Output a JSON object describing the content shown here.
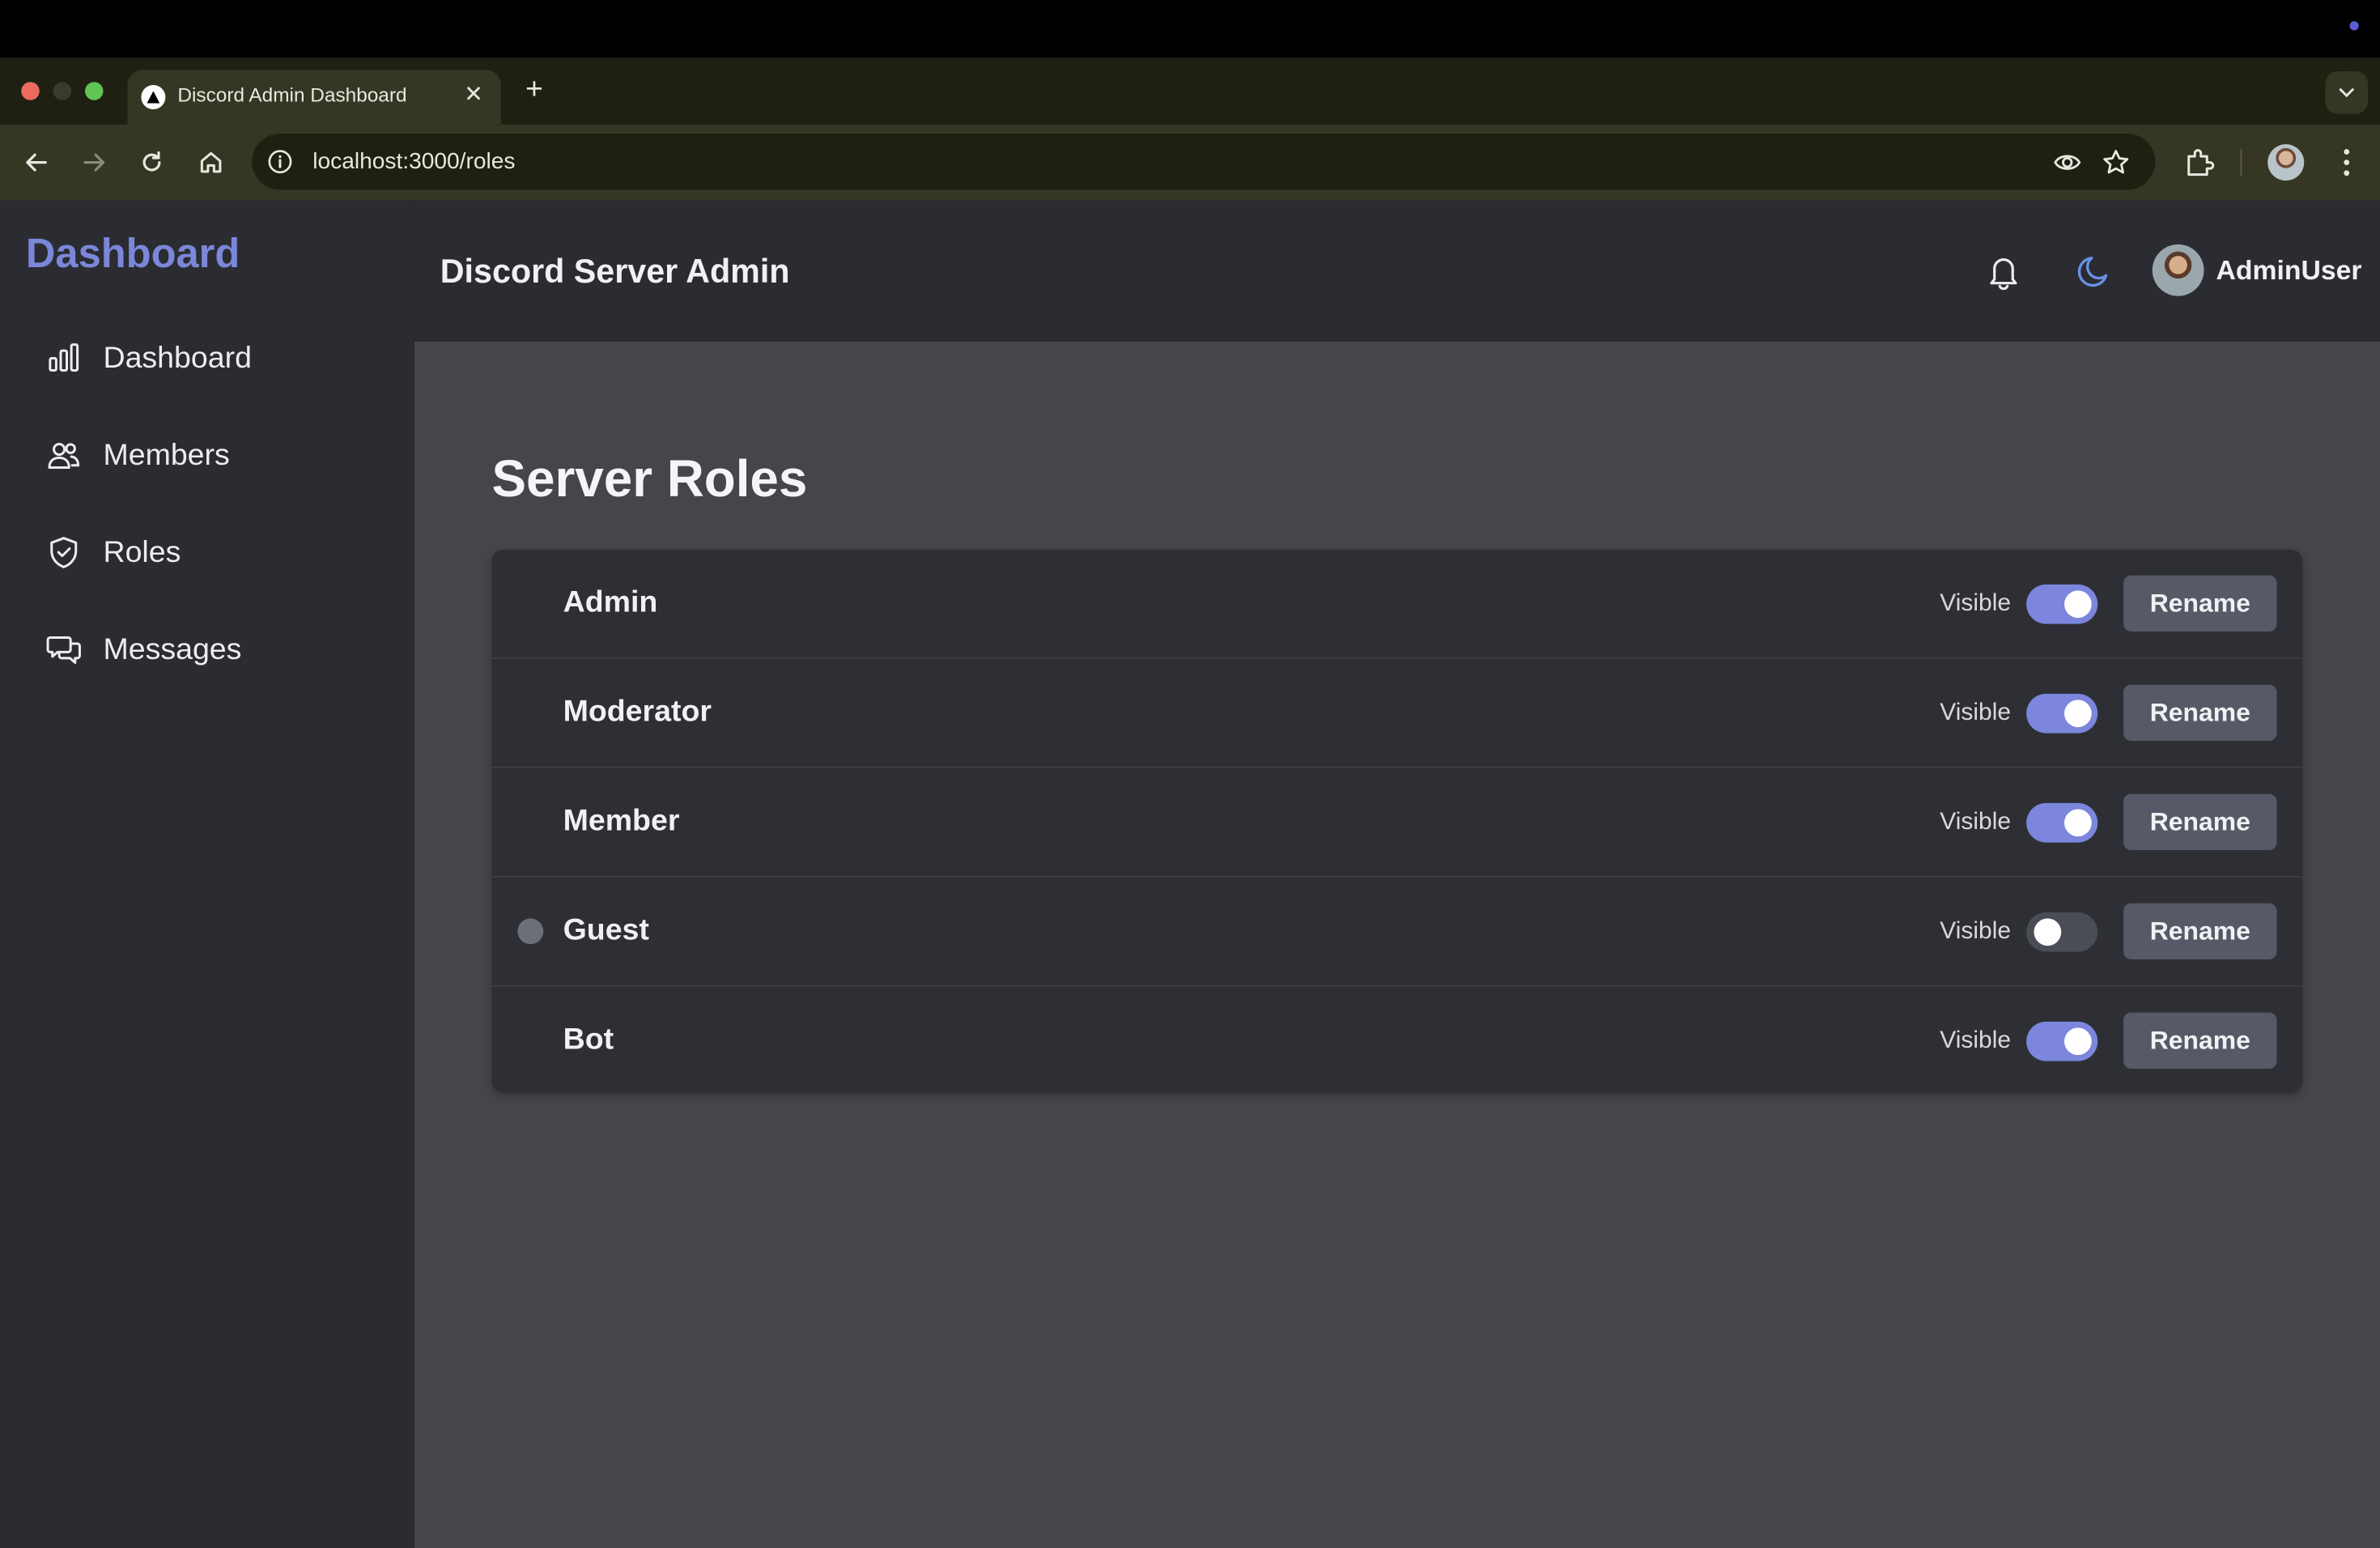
{
  "browser": {
    "tab_title": "Discord Admin Dashboard",
    "tab_close": "✕",
    "new_tab": "+",
    "url": "localhost:3000/roles"
  },
  "sidebar": {
    "brand": "Dashboard",
    "items": [
      {
        "label": "Dashboard",
        "icon": "bar-chart-icon"
      },
      {
        "label": "Members",
        "icon": "users-icon"
      },
      {
        "label": "Roles",
        "icon": "shield-check-icon"
      },
      {
        "label": "Messages",
        "icon": "chat-bubbles-icon"
      }
    ]
  },
  "header": {
    "title": "Discord Server Admin",
    "username": "AdminUser"
  },
  "main": {
    "title": "Server Roles",
    "visible_label": "Visible",
    "rename_label": "Rename",
    "roles": [
      {
        "name": "Admin",
        "visible": true,
        "indicator": false
      },
      {
        "name": "Moderator",
        "visible": true,
        "indicator": false
      },
      {
        "name": "Member",
        "visible": true,
        "indicator": false
      },
      {
        "name": "Guest",
        "visible": false,
        "indicator": true
      },
      {
        "name": "Bot",
        "visible": true,
        "indicator": false
      }
    ]
  },
  "colors": {
    "accent": "#7b86dc",
    "brand": "#7b87d8",
    "sidebar_bg": "#2b2c31",
    "main_bg": "#45464b"
  }
}
